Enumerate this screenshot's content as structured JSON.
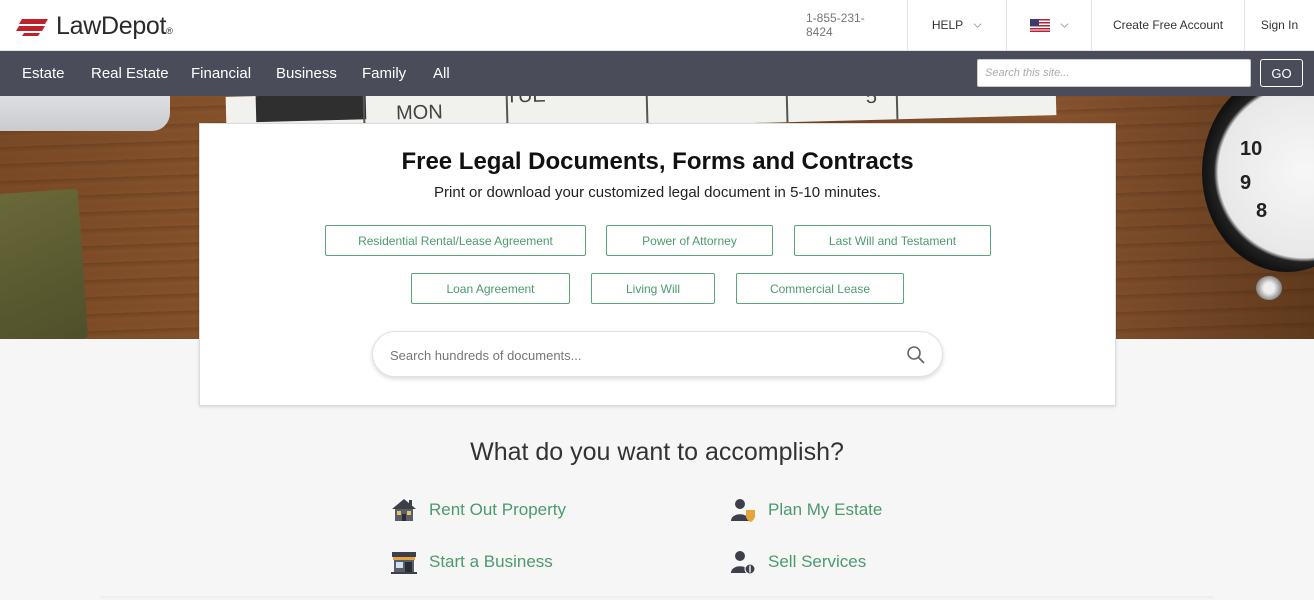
{
  "header": {
    "logo_text": "LawDepot",
    "logo_reg": "®",
    "phone": "1-855-231-8424",
    "help_label": "HELP",
    "flag_icon": "us-flag-icon",
    "create_account": "Create Free Account",
    "sign_in": "Sign In",
    "brand_color": "#c0202a"
  },
  "nav": {
    "items": [
      "Estate",
      "Real Estate",
      "Financial",
      "Business",
      "Family",
      "All"
    ],
    "search_placeholder": "Search this site...",
    "go_label": "GO",
    "background": "#4a4c5a"
  },
  "hero": {
    "calendar_words": [
      "MON",
      "TUE",
      "5"
    ],
    "clock_numbers": [
      "10",
      "9",
      "8"
    ]
  },
  "card": {
    "title": "Free Legal Documents, Forms and Contracts",
    "subtitle": "Print or download your customized legal document in 5-10 minutes.",
    "documents_row1": [
      "Residential Rental/Lease Agreement",
      "Power of Attorney",
      "Last Will and Testament"
    ],
    "documents_row2": [
      "Loan Agreement",
      "Living Will",
      "Commercial Lease"
    ],
    "search_placeholder": "Search hundreds of documents...",
    "accent_color": "#4c9a6d"
  },
  "accomplish": {
    "title": "What do you want to accomplish?",
    "goals": [
      {
        "label": "Rent Out Property",
        "icon": "house-icon"
      },
      {
        "label": "Plan My Estate",
        "icon": "person-shield-icon"
      },
      {
        "label": "Start a Business",
        "icon": "storefront-icon"
      },
      {
        "label": "Sell Services",
        "icon": "person-dollar-icon"
      }
    ]
  }
}
